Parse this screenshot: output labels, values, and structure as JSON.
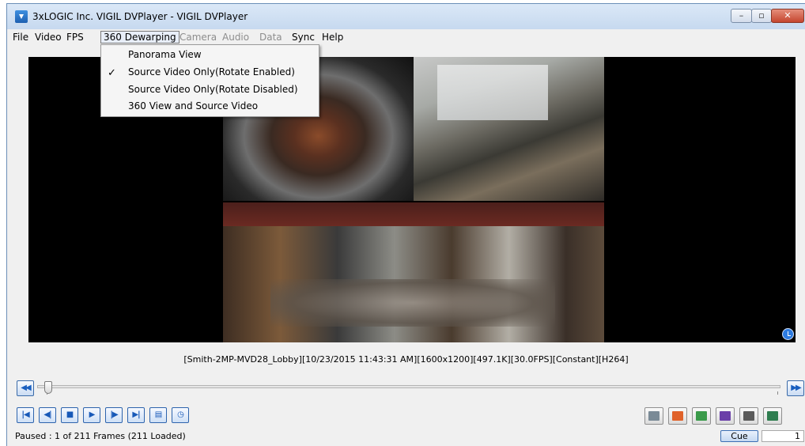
{
  "window": {
    "title": "3xLOGIC Inc. VIGIL DVPlayer - VIGIL DVPlayer",
    "controls": {
      "minimize": "–",
      "maximize": "▫",
      "close": "✕"
    }
  },
  "menubar": {
    "items": [
      {
        "label": "File",
        "state": "enabled"
      },
      {
        "label": "Video",
        "state": "enabled"
      },
      {
        "label": "FPS",
        "state": "enabled"
      },
      {
        "label": "360 Dewarping",
        "state": "open"
      },
      {
        "label": "Camera",
        "state": "disabled"
      },
      {
        "label": "Audio",
        "state": "disabled"
      },
      {
        "label": "Data",
        "state": "disabled"
      },
      {
        "label": "Sync",
        "state": "enabled"
      },
      {
        "label": "Help",
        "state": "enabled"
      }
    ]
  },
  "dropdown": {
    "items": [
      {
        "label": "Panorama View",
        "checked": false
      },
      {
        "label": "Source Video Only(Rotate Enabled)",
        "checked": true
      },
      {
        "label": "Source Video Only(Rotate Disabled)",
        "checked": false
      },
      {
        "label": "360 View and Source Video",
        "checked": false
      }
    ],
    "check_glyph": "✓"
  },
  "video": {
    "info": "[Smith-2MP-MVD28_Lobby][10/23/2015 11:43:31 AM][1600x1200][497.1K][30.0FPS][Constant][H264]"
  },
  "timeline": {
    "rewind_glyph": "◀◀",
    "forward_glyph": "▶▶",
    "position_fraction": 0.0
  },
  "playback": {
    "buttons": [
      {
        "name": "first-frame",
        "glyph": "|◀"
      },
      {
        "name": "step-back",
        "glyph": "◀|"
      },
      {
        "name": "stop",
        "glyph": "■"
      },
      {
        "name": "play",
        "glyph": "▶"
      },
      {
        "name": "step-forward",
        "glyph": "|▶"
      },
      {
        "name": "last-frame",
        "glyph": "▶|"
      },
      {
        "name": "layout",
        "glyph": "▤"
      },
      {
        "name": "clock",
        "glyph": "◷"
      }
    ]
  },
  "tools": {
    "buttons": [
      {
        "name": "snapshot",
        "color": "#7a8a96"
      },
      {
        "name": "export",
        "color": "#e0622a"
      },
      {
        "name": "refresh",
        "color": "#3a9a4a"
      },
      {
        "name": "save",
        "color": "#6b3fa8"
      },
      {
        "name": "print",
        "color": "#5a5a5a"
      },
      {
        "name": "fullscreen",
        "color": "#2e7d4f"
      }
    ]
  },
  "status": {
    "text": "Paused : 1 of 211 Frames (211 Loaded)",
    "cue_label": "Cue",
    "cue_value": "1"
  }
}
